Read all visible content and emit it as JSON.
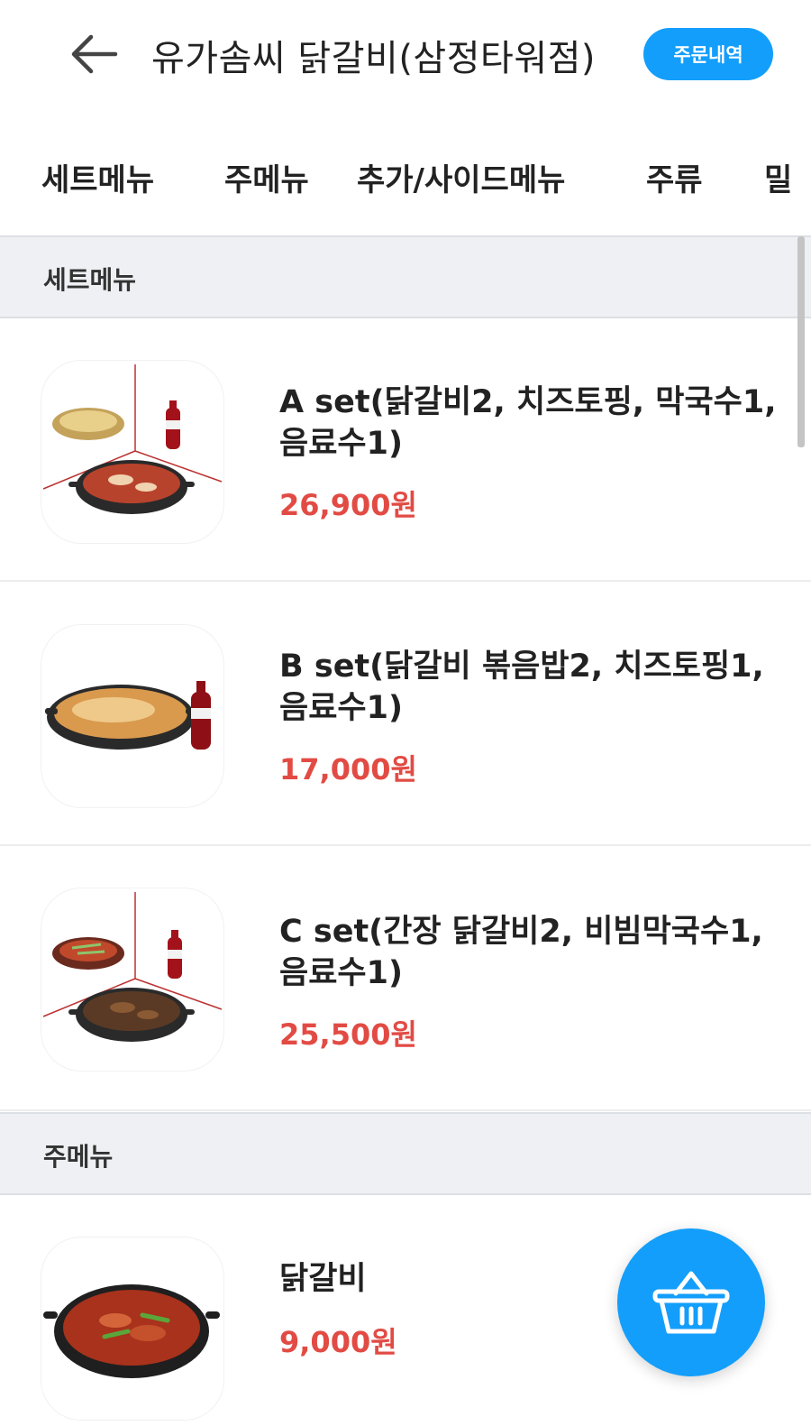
{
  "header": {
    "store_name": "유가솜씨 닭갈비(삼정타워점)",
    "order_history_label": "주문내역",
    "back_icon": "arrow-left-icon"
  },
  "categories": [
    "세트메뉴",
    "주메뉴",
    "추가/사이드메뉴",
    "주류",
    "밀"
  ],
  "sections": [
    {
      "title": "세트메뉴",
      "items": [
        {
          "name": "A set(닭갈비2, 치즈토핑, 막국수1, 음료수1)",
          "price": "26,900원",
          "image": "dakgalbi-noodle-cola-set"
        },
        {
          "name": "B set(닭갈비 볶음밥2, 치즈토핑1, 음료수1)",
          "price": "17,000원",
          "image": "cheese-fried-rice-cola-set"
        },
        {
          "name": "C set(간장 닭갈비2, 비빔막국수1, 음료수1)",
          "price": "25,500원",
          "image": "soy-dakgalbi-noodle-cola-set"
        }
      ]
    },
    {
      "title": "주메뉴",
      "items": [
        {
          "name": "닭갈비",
          "price": "9,000원",
          "image": "dakgalbi-pan"
        }
      ]
    }
  ],
  "colors": {
    "accent": "#139efb",
    "price": "#e24b44",
    "section_bg": "#eef0f3"
  },
  "cart_icon": "shopping-basket-icon"
}
